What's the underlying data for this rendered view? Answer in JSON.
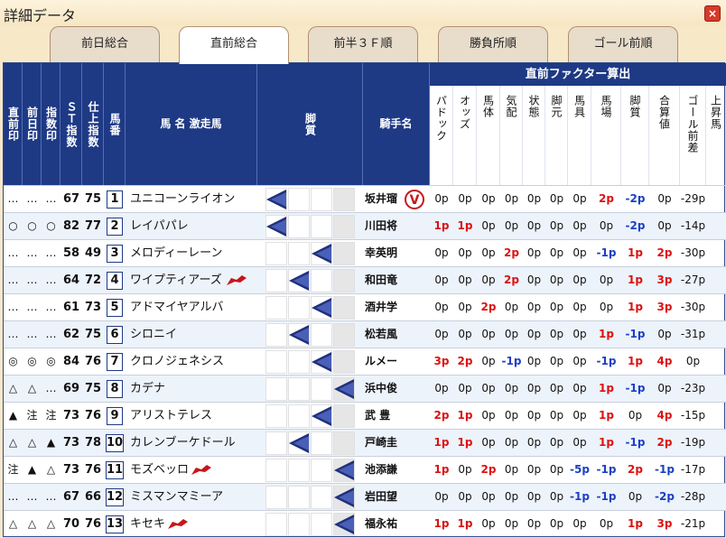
{
  "window": {
    "title": "詳細データ",
    "close_label": "×"
  },
  "tabs": [
    "前日総合",
    "直前総合",
    "前半３Ｆ順",
    "勝負所順",
    "ゴール前順"
  ],
  "active_tab_index": 1,
  "header": {
    "col_chokuzen": "直前印",
    "col_zenjitsu": "前日印",
    "col_shisu": "指数印",
    "col_st": "ＳＴ指数",
    "col_shiage": "仕上指数",
    "col_umaban": "馬番",
    "col_name": "馬 名  激走馬",
    "col_kyakushitsu": "脚質",
    "col_jockey": "騎手名",
    "factor_title": "直前ファクター算出",
    "factors": [
      "パドック",
      "オッズ",
      "馬体",
      "気配",
      "状態",
      "脚元",
      "馬具",
      "馬場",
      "脚質",
      "合算値",
      "ゴール前差",
      "上昇馬"
    ]
  },
  "rows": [
    {
      "marks": [
        "…",
        "…",
        "…"
      ],
      "st": "67",
      "shiage": "75",
      "umaban": "1",
      "name": "ユニコーンライオン",
      "gekiso": false,
      "kyaku": 0,
      "jockey": "坂井瑠",
      "jockey_badge": "V",
      "f": [
        "0p",
        "0p",
        "0p",
        "0p",
        "0p",
        "0p",
        "0p",
        "2p",
        "-2p",
        "0p",
        "-29p"
      ]
    },
    {
      "marks": [
        "○",
        "○",
        "○"
      ],
      "st": "82",
      "shiage": "77",
      "umaban": "2",
      "name": "レイパパレ",
      "gekiso": false,
      "kyaku": 0,
      "jockey": "川田将",
      "jockey_badge": "",
      "f": [
        "1p",
        "1p",
        "0p",
        "0p",
        "0p",
        "0p",
        "0p",
        "0p",
        "-2p",
        "0p",
        "-14p"
      ]
    },
    {
      "marks": [
        "…",
        "…",
        "…"
      ],
      "st": "58",
      "shiage": "49",
      "umaban": "3",
      "name": "メロディーレーン",
      "gekiso": false,
      "kyaku": 2,
      "jockey": "幸英明",
      "jockey_badge": "",
      "f": [
        "0p",
        "0p",
        "0p",
        "2p",
        "0p",
        "0p",
        "0p",
        "-1p",
        "1p",
        "2p",
        "-30p"
      ]
    },
    {
      "marks": [
        "…",
        "…",
        "…"
      ],
      "st": "64",
      "shiage": "72",
      "umaban": "4",
      "name": "ワイプティアーズ",
      "gekiso": true,
      "kyaku": 1,
      "jockey": "和田竜",
      "jockey_badge": "",
      "f": [
        "0p",
        "0p",
        "0p",
        "2p",
        "0p",
        "0p",
        "0p",
        "0p",
        "1p",
        "3p",
        "-27p"
      ]
    },
    {
      "marks": [
        "…",
        "…",
        "…"
      ],
      "st": "61",
      "shiage": "73",
      "umaban": "5",
      "name": "アドマイヤアルバ",
      "gekiso": false,
      "kyaku": 2,
      "jockey": "酒井学",
      "jockey_badge": "",
      "f": [
        "0p",
        "0p",
        "2p",
        "0p",
        "0p",
        "0p",
        "0p",
        "0p",
        "1p",
        "3p",
        "-30p"
      ]
    },
    {
      "marks": [
        "…",
        "…",
        "…"
      ],
      "st": "62",
      "shiage": "75",
      "umaban": "6",
      "name": "シロニイ",
      "gekiso": false,
      "kyaku": 1,
      "jockey": "松若風",
      "jockey_badge": "",
      "f": [
        "0p",
        "0p",
        "0p",
        "0p",
        "0p",
        "0p",
        "0p",
        "1p",
        "-1p",
        "0p",
        "-31p"
      ]
    },
    {
      "marks": [
        "◎",
        "◎",
        "◎"
      ],
      "st": "84",
      "shiage": "76",
      "umaban": "7",
      "name": "クロノジェネシス",
      "gekiso": false,
      "kyaku": 2,
      "jockey": "ルメー",
      "jockey_badge": "",
      "f": [
        "3p",
        "2p",
        "0p",
        "-1p",
        "0p",
        "0p",
        "0p",
        "-1p",
        "1p",
        "4p",
        "0p"
      ]
    },
    {
      "marks": [
        "△",
        "△",
        "…"
      ],
      "st": "69",
      "shiage": "75",
      "umaban": "8",
      "name": "カデナ",
      "gekiso": false,
      "kyaku": 3,
      "jockey": "浜中俊",
      "jockey_badge": "",
      "f": [
        "0p",
        "0p",
        "0p",
        "0p",
        "0p",
        "0p",
        "0p",
        "1p",
        "-1p",
        "0p",
        "-23p"
      ]
    },
    {
      "marks": [
        "▲",
        "注",
        "注"
      ],
      "st": "73",
      "shiage": "76",
      "umaban": "9",
      "name": "アリストテレス",
      "gekiso": false,
      "kyaku": 2,
      "jockey": "武 豊",
      "jockey_badge": "",
      "f": [
        "2p",
        "1p",
        "0p",
        "0p",
        "0p",
        "0p",
        "0p",
        "1p",
        "0p",
        "4p",
        "-15p"
      ]
    },
    {
      "marks": [
        "△",
        "△",
        "▲"
      ],
      "st": "73",
      "shiage": "78",
      "umaban": "10",
      "name": "カレンブーケドール",
      "gekiso": false,
      "kyaku": 1,
      "jockey": "戸崎圭",
      "jockey_badge": "",
      "f": [
        "1p",
        "1p",
        "0p",
        "0p",
        "0p",
        "0p",
        "0p",
        "1p",
        "-1p",
        "2p",
        "-19p"
      ]
    },
    {
      "marks": [
        "注",
        "▲",
        "△"
      ],
      "st": "73",
      "shiage": "76",
      "umaban": "11",
      "name": "モズベッロ",
      "gekiso": true,
      "kyaku": 3,
      "jockey": "池添謙",
      "jockey_badge": "",
      "f": [
        "1p",
        "0p",
        "2p",
        "0p",
        "0p",
        "0p",
        "-5p",
        "-1p",
        "2p",
        "-1p",
        "-17p"
      ]
    },
    {
      "marks": [
        "…",
        "…",
        "…"
      ],
      "st": "67",
      "shiage": "66",
      "umaban": "12",
      "name": "ミスマンマミーア",
      "gekiso": false,
      "kyaku": 3,
      "jockey": "岩田望",
      "jockey_badge": "",
      "f": [
        "0p",
        "0p",
        "0p",
        "0p",
        "0p",
        "0p",
        "-1p",
        "-1p",
        "0p",
        "-2p",
        "-28p"
      ]
    },
    {
      "marks": [
        "△",
        "△",
        "△"
      ],
      "st": "70",
      "shiage": "76",
      "umaban": "13",
      "name": "キセキ",
      "gekiso": true,
      "kyaku": 3,
      "jockey": "福永祐",
      "jockey_badge": "",
      "f": [
        "1p",
        "1p",
        "0p",
        "0p",
        "0p",
        "0p",
        "0p",
        "0p",
        "1p",
        "3p",
        "-21p"
      ]
    }
  ]
}
